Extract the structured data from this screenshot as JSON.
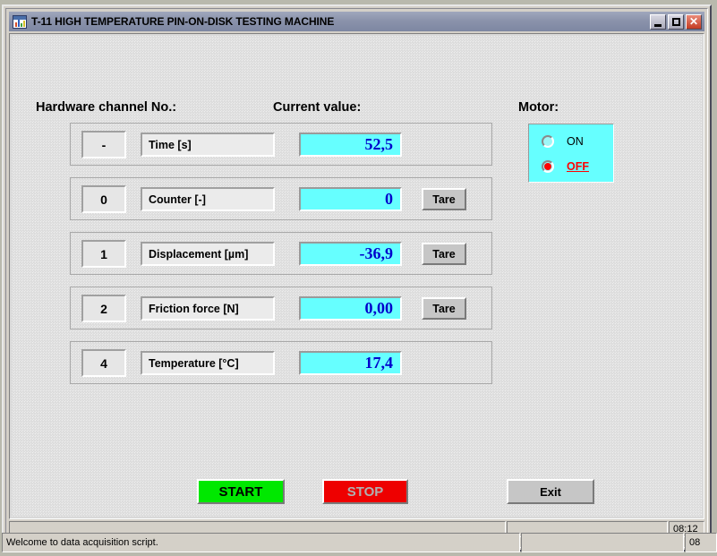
{
  "window": {
    "title": "T-11 HIGH TEMPERATURE PIN-ON-DISK TESTING MACHINE",
    "icon": "chart-window-icon",
    "controls": {
      "minimize": "minimize-icon",
      "maximize": "maximize-icon",
      "close": "✕"
    }
  },
  "headers": {
    "channel": "Hardware channel No.:",
    "value": "Current value:",
    "motor": "Motor:"
  },
  "channels": [
    {
      "no": "-",
      "label": "Time [s]",
      "value": "52,5",
      "tare": null,
      "has_tare": false
    },
    {
      "no": "0",
      "label": "Counter [-]",
      "value": "0",
      "tare": "Tare",
      "has_tare": true
    },
    {
      "no": "1",
      "label": "Displacement [µm]",
      "value": "-36,9",
      "tare": "Tare",
      "has_tare": true
    },
    {
      "no": "2",
      "label": "Friction force [N]",
      "value": "0,00",
      "tare": "Tare",
      "has_tare": true
    },
    {
      "no": "4",
      "label": "Temperature [°C]",
      "value": "17,4",
      "tare": null,
      "has_tare": false
    }
  ],
  "motor": {
    "options": [
      {
        "label": "ON",
        "selected": false
      },
      {
        "label": "OFF",
        "selected": true
      }
    ]
  },
  "actions": {
    "start": "START",
    "stop": "STOP",
    "exit": "Exit"
  },
  "status": {
    "inner_message": "",
    "inner_field": "",
    "inner_clock": "08:12",
    "outer_message": "Welcome to data acquisition script.",
    "outer_field": "",
    "outer_clock": "08"
  },
  "colors": {
    "value_field_bg": "#66FFFF",
    "value_text": "#0000CC",
    "start_bg": "#00E800",
    "stop_bg": "#EE0000",
    "selected_radio": "#FF0000",
    "titlebar": "#8B93AB"
  }
}
